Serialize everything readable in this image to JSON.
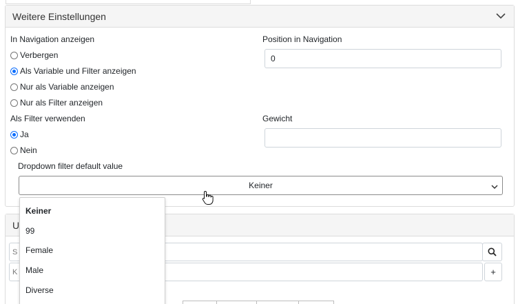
{
  "panel": {
    "title": "Weitere Einstellungen"
  },
  "navigation": {
    "label": "In Navigation anzeigen",
    "options": [
      "Verbergen",
      "Als Variable und Filter anzeigen",
      "Nur als Variable anzeigen",
      "Nur als Filter anzeigen"
    ],
    "selected": "Als Variable und Filter anzeigen"
  },
  "position": {
    "label": "Position in Navigation",
    "value": "0"
  },
  "filter_use": {
    "label": "Als Filter verwenden",
    "options": [
      "Ja",
      "Nein"
    ],
    "selected": "Ja"
  },
  "weight": {
    "label": "Gewicht",
    "value": ""
  },
  "dropdown_default": {
    "label": "Dropdown filter default value",
    "selected": "Keiner",
    "options": [
      "Keiner",
      "99",
      "Female",
      "Male",
      "Diverse"
    ]
  },
  "panel2": {
    "title_partial": "U",
    "search_prefix": "S",
    "add_prefix": "K",
    "add_label": "+"
  },
  "colors": {
    "accent": "#0d6efd",
    "header_bg": "#f5f5f5",
    "border": "#dcdcdc"
  }
}
